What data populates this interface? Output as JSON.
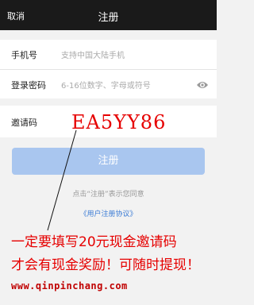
{
  "header": {
    "cancel_label": "取消",
    "title": "注册"
  },
  "form": {
    "phone_label": "手机号",
    "phone_placeholder": "支持中国大陆手机",
    "password_label": "登录密码",
    "password_placeholder": "6-16位数字、字母或符号",
    "invite_label": "邀请码",
    "invite_code": "EA5YY86"
  },
  "submit_label": "注册",
  "agree_text": "点击“注册”表示您同意",
  "agreement_link": "《用户注册协议》",
  "promo": {
    "line1": "一定要填写20元现金邀请码",
    "line2": "才会有现金奖励！可随时提现！",
    "site": "www.qinpinchang.com"
  },
  "colors": {
    "header_bg": "#1a1a1a",
    "button_bg": "#a9c6ef",
    "promo_red": "#e60000",
    "link_blue": "#3a7bd5"
  }
}
